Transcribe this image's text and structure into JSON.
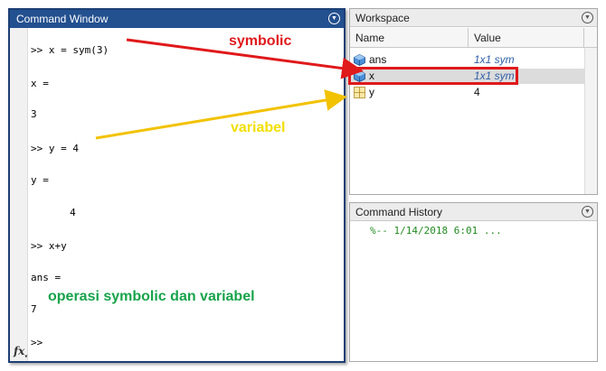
{
  "command_window": {
    "title": "Command Window",
    "lines": [
      ">> x = sym(3)",
      "x =",
      "3",
      ">> y = 4",
      "y =",
      "     4",
      ">> x+y",
      "ans =",
      "7",
      ">>"
    ],
    "fx_icon": "fx"
  },
  "workspace": {
    "title": "Workspace",
    "columns": {
      "name": "Name",
      "value": "Value"
    },
    "variables": [
      {
        "name": "ans",
        "value": "1x1 sym",
        "icon": "sym-cube-icon"
      },
      {
        "name": "x",
        "value": "1x1 sym",
        "icon": "sym-cube-icon"
      },
      {
        "name": "y",
        "value": "4",
        "icon": "grid-matrix-icon"
      }
    ]
  },
  "command_history": {
    "title": "Command History",
    "entries": [
      "%-- 1/14/2018 6:01 ..."
    ]
  },
  "annotations": {
    "symbolic": "symbolic",
    "variabel": "variabel",
    "operasi": "operasi symbolic dan variabel",
    "colors": {
      "red": "#e0191b",
      "yellow": "#f2df00",
      "green": "#17a34a"
    }
  }
}
